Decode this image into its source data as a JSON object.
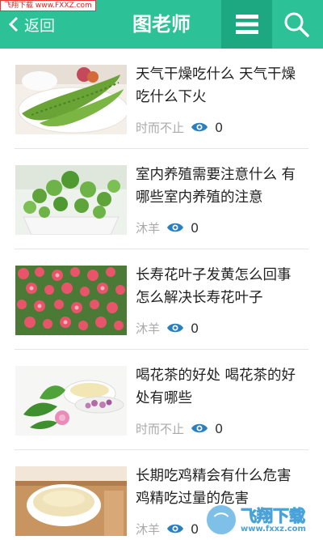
{
  "header": {
    "back_label": "返回",
    "title": "图老师",
    "accent": "#2cc196"
  },
  "watermark": {
    "top_text": "飞翔下载 www.FXXZ.com",
    "corner_cn": "飞翔下载",
    "corner_url": "www.fxxz.com"
  },
  "articles": [
    {
      "title": "天气干燥吃什么 天气干燥吃什么下火",
      "author": "时而不止",
      "views": "0",
      "image": "bitter-melon"
    },
    {
      "title": "室内养殖需要注意什么 有哪些室内养殖的注意",
      "author": "沐羊",
      "views": "0",
      "image": "potted-plant"
    },
    {
      "title": "长寿花叶子发黄怎么回事 怎么解决长寿花叶子",
      "author": "沐羊",
      "views": "0",
      "image": "kalanchoe-flowers"
    },
    {
      "title": "喝花茶的好处 喝花茶的好处有哪些",
      "author": "时而不止",
      "views": "0",
      "image": "flower-tea"
    },
    {
      "title": "长期吃鸡精会有什么危害 鸡精吃过量的危害",
      "author": "沐羊",
      "views": "0",
      "image": "chicken-essence"
    }
  ]
}
